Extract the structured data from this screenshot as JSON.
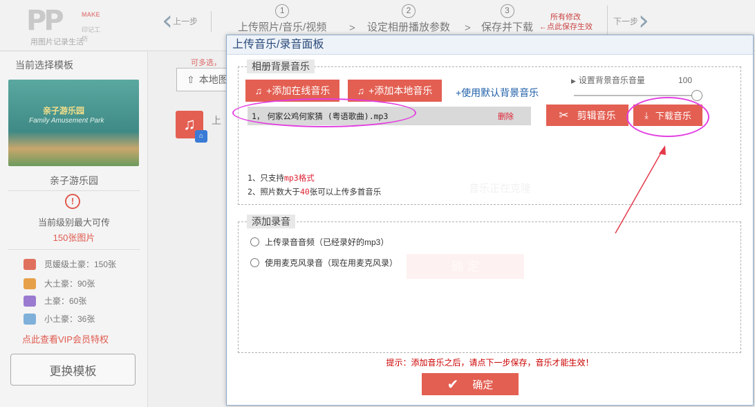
{
  "header": {
    "logo_text": "PP",
    "logo_make": "MAKE",
    "logo_sub1": "印记工坊",
    "logo_sub2": "用图片记录生活",
    "prev_label": "上一步",
    "next_label": "下一步",
    "steps": [
      {
        "num": "1",
        "label": "上传照片/音乐/视频"
      },
      {
        "num": "2",
        "label": "设定相册播放参数"
      },
      {
        "num": "3",
        "label": "保存并下载"
      }
    ],
    "step_arrow": ">",
    "save_hint_line1": "所有修改",
    "save_hint_line2": "点此保存生效"
  },
  "sidebar": {
    "title": "当前选择模板",
    "thumb_title": "亲子游乐园",
    "thumb_subtitle": "Family Amusement Park",
    "template_name": "亲子游乐园",
    "warn_icon": "!",
    "max_label": "当前级别最大可传",
    "max_count": "150张图片",
    "tiers": [
      {
        "label": "觅媛级土豪：150张",
        "color": "#e0705e"
      },
      {
        "label": "大土豪：90张",
        "color": "#e7a04a"
      },
      {
        "label": "土豪：60张",
        "color": "#9a7bd0"
      },
      {
        "label": "小土豪：36张",
        "color": "#7fb0d9"
      }
    ],
    "vip_link": "点此查看VIP会员特权",
    "change_template": "更换模板"
  },
  "background": {
    "note": "可多选，",
    "local_button": "本地图",
    "upload_label": "上"
  },
  "modal": {
    "title": "上传音乐/录音面板",
    "bgm_legend": "相册背景音乐",
    "add_online": "+添加在线音乐",
    "add_local": "+添加本地音乐",
    "use_default": "+使用默认背景音乐",
    "volume_label": "设置背景音乐音量",
    "volume_value": "100",
    "volume_level": 1.0,
    "songs": [
      {
        "index": "1，",
        "name": "何家公鸡何家猜 (粤语歌曲).mp3",
        "delete": "删除"
      }
    ],
    "edit_music": "剪辑音乐",
    "download_music": "下载音乐",
    "notes": [
      {
        "prefix": "1、只支持",
        "highlight": "mp3格式",
        "suffix": ""
      },
      {
        "prefix": "2、照片数大于",
        "highlight": "40",
        "suffix": "张可以上传多首音乐"
      }
    ],
    "record_legend": "添加录音",
    "record_options": [
      "上传录音音频（已经录好的mp3）",
      "使用麦克风录音（现在用麦克风录）"
    ],
    "tip": "提示：添加音乐之后，请点下一步保存，音乐才能生效！",
    "confirm": "确定",
    "ghost_text_1": "音乐正在克隆",
    "ghost_text_2": "确 定"
  },
  "colors": {
    "accent_red": "#e35f52",
    "link_blue": "#1e5ea8",
    "highlight_magenta": "#e23fe0"
  }
}
